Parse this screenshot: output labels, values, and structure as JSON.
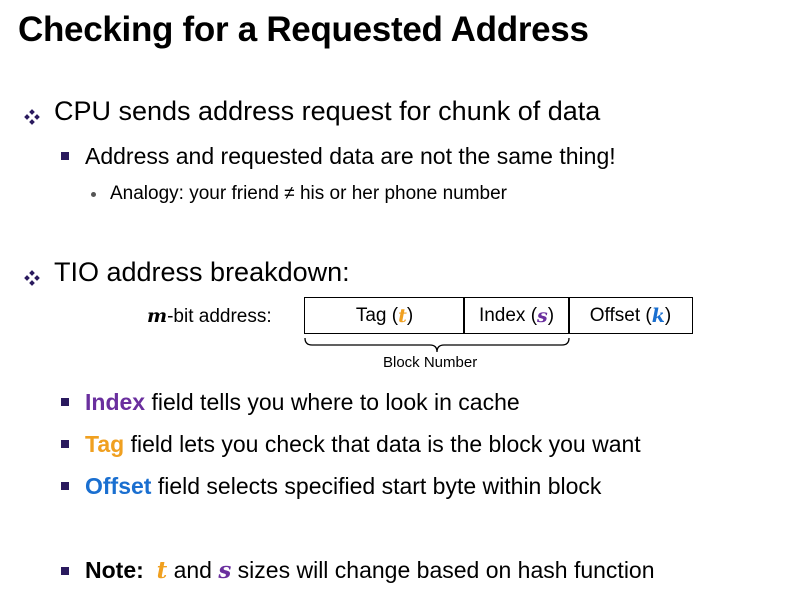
{
  "title": "Checking for a Requested Address",
  "bullet1": "CPU sends address request for chunk of data",
  "sub1": "Address and requested data are not the same thing!",
  "subsub1": "Analogy:  your friend ≠ his or her phone number",
  "bullet2": "TIO address breakdown:",
  "address_label": {
    "var": "m",
    "text": "-bit address:"
  },
  "fields": [
    {
      "name": "Tag",
      "var": "t",
      "color": "#f0a020"
    },
    {
      "name": "Index",
      "var": "s",
      "color": "#6a2f9e"
    },
    {
      "name": "Offset",
      "var": "k",
      "color": "#1a6fd0"
    }
  ],
  "block_number_label": "Block Number",
  "sub_points": [
    {
      "keyword": "Index",
      "text": " field tells you where to look in cache"
    },
    {
      "keyword": "Tag",
      "text": " field lets you check that data is the block you want"
    },
    {
      "keyword": "Offset",
      "text": " field selects specified start byte within block"
    }
  ],
  "note": {
    "label": "Note:",
    "var1": "t",
    "and": " and ",
    "var2": "s",
    "text": " sizes will change based on hash function"
  },
  "colors": {
    "index": "#6a2f9e",
    "tag": "#f0a020",
    "offset": "#1a6fd0",
    "bullet_square": "#2a1a5e"
  },
  "icons": {
    "level1": "diamond-bullet-icon",
    "level2": "square-bullet-icon",
    "level3": "dot-bullet-icon"
  }
}
